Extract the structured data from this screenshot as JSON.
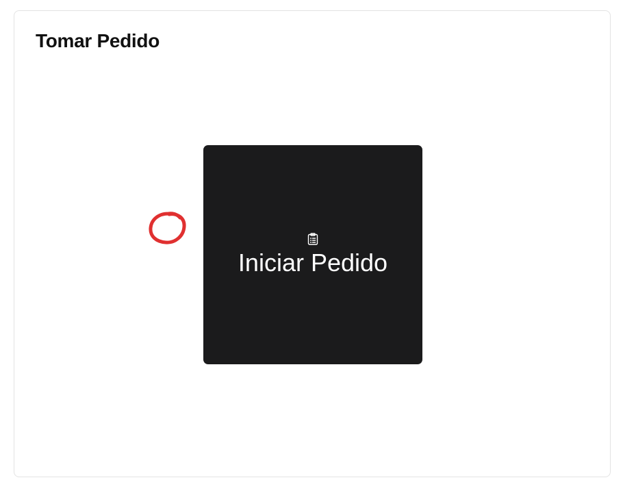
{
  "card": {
    "title": "Tomar Pedido"
  },
  "start_order_button": {
    "label": "Iniciar Pedido",
    "icon": "clipboard-list-icon",
    "background": "#1b1b1c"
  },
  "annotation": {
    "icon": "red-circle-mark",
    "color": "#e03030"
  }
}
